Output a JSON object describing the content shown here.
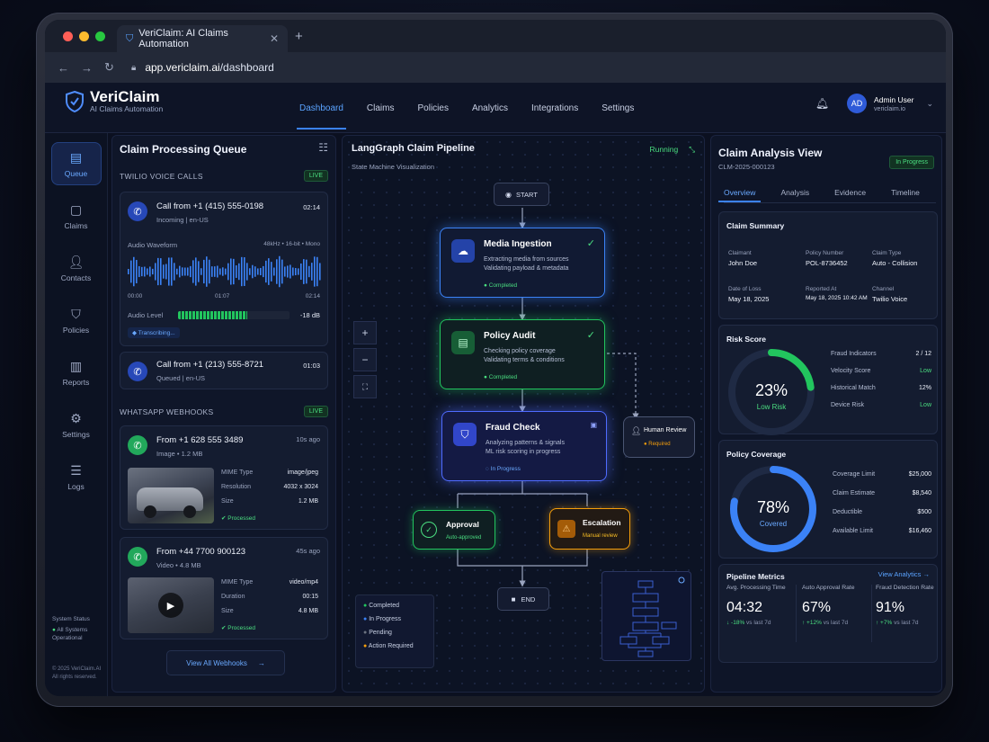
{
  "browser": {
    "tab_title": "VeriClaim: AI Claims Automation",
    "url_host": "app.vericlaim.ai",
    "url_path": "/dashboard"
  },
  "header": {
    "brand": "VeriClaim",
    "tagline": "AI Claims Automation",
    "nav": [
      "Dashboard",
      "Claims",
      "Policies",
      "Analytics",
      "Integrations",
      "Settings"
    ],
    "active_nav": "Dashboard",
    "user_initials": "AD",
    "user_name": "Admin User",
    "user_org": "vericlaim.io"
  },
  "sidebar": {
    "items": [
      {
        "label": "Queue",
        "icon": "queue-icon"
      },
      {
        "label": "Claims",
        "icon": "file-icon"
      },
      {
        "label": "Contacts",
        "icon": "contacts-icon"
      },
      {
        "label": "Policies",
        "icon": "shield-icon"
      },
      {
        "label": "Reports",
        "icon": "bar-chart-icon"
      },
      {
        "label": "Settings",
        "icon": "gear-icon"
      },
      {
        "label": "Logs",
        "icon": "logs-icon"
      }
    ],
    "status_title": "System Status",
    "status_text": "All Systems Operational",
    "copyright": "© 2025 VeriClaim.AI All rights reserved."
  },
  "queue": {
    "title": "Claim Processing Queue",
    "voice_section": "TWILIO VOICE CALLS",
    "voice_badge": "LIVE",
    "call1": {
      "title": "Call from +1 (415) 555-0198",
      "sub": "Incoming | en-US",
      "time": "02:14",
      "waveform_label": "Audio Waveform",
      "waveform_spec": "48kHz • 16-bit • Mono",
      "t0": "00:00",
      "t1": "01:07",
      "t2": "02:14",
      "level_label": "Audio Level",
      "level_db": "-18 dB",
      "level": 0.62,
      "transcribing": "Transcribing..."
    },
    "call2": {
      "title": "Call from +1 (213) 555-8721",
      "sub": "Queued | en-US",
      "time": "01:03"
    },
    "wa_section": "WHATSAPP WEBHOOKS",
    "wa_badge": "LIVE",
    "wa1": {
      "from": "From +1 628 555 3489",
      "ago": "10s ago",
      "sub": "Image • 1.2 MB",
      "k1": "MIME Type",
      "v1": "image/jpeg",
      "k2": "Resolution",
      "v2": "4032 x 3024",
      "k3": "Size",
      "v3": "1.2 MB",
      "status": "Processed"
    },
    "wa2": {
      "from": "From +44 7700 900123",
      "ago": "45s ago",
      "sub": "Video • 4.8 MB",
      "k1": "MIME Type",
      "v1": "video/mp4",
      "k2": "Duration",
      "v2": "00:15",
      "k3": "Size",
      "v3": "4.8 MB",
      "status": "Processed"
    },
    "view_all": "View All Webhooks"
  },
  "pipeline": {
    "title": "LangGraph Claim Pipeline",
    "subtitle": "State Machine Visualization",
    "status": "Running",
    "start": "START",
    "end": "END",
    "nodes": {
      "media": {
        "title": "Media Ingestion",
        "d1": "Extracting media from sources",
        "d2": "Validating payload & metadata",
        "status": "Completed"
      },
      "policy": {
        "title": "Policy Audit",
        "d1": "Checking policy coverage",
        "d2": "Validating terms & conditions",
        "status": "Completed"
      },
      "fraud": {
        "title": "Fraud Check",
        "d1": "Analyzing patterns & signals",
        "d2": "ML risk scoring in progress",
        "status": "In Progress"
      },
      "human": {
        "title": "Human Review",
        "status": "Required"
      },
      "approval": {
        "title": "Approval",
        "status": "Auto-approved"
      },
      "escalation": {
        "title": "Escalation",
        "status": "Manual review"
      }
    },
    "legend": [
      "Completed",
      "In Progress",
      "Pending",
      "Action Required"
    ],
    "legend_colors": [
      "#22c55e",
      "#3b82f6",
      "#6b7280",
      "#f59e0b"
    ]
  },
  "analysis": {
    "title": "Claim Analysis View",
    "claim_id": "CLM-2025-000123",
    "status": "In Progress",
    "tabs": [
      "Overview",
      "Analysis",
      "Evidence",
      "Timeline"
    ],
    "summary_title": "Claim Summary",
    "summary": [
      {
        "k": "Claimant",
        "v": "John Doe"
      },
      {
        "k": "Policy Number",
        "v": "POL-8736452"
      },
      {
        "k": "Claim Type",
        "v": "Auto - Collision"
      },
      {
        "k": "Date of Loss",
        "v": "May 18, 2025"
      },
      {
        "k": "Reported At",
        "v": "May 18, 2025 10:42 AM"
      },
      {
        "k": "Channel",
        "v": "Twilio Voice"
      }
    ],
    "risk": {
      "title": "Risk Score",
      "value": "23%",
      "fraction": 0.23,
      "label": "Low Risk",
      "rows": [
        {
          "k": "Fraud Indicators",
          "v": "2 / 12"
        },
        {
          "k": "Velocity Score",
          "v": "Low"
        },
        {
          "k": "Historical Match",
          "v": "12%"
        },
        {
          "k": "Device Risk",
          "v": "Low"
        }
      ]
    },
    "coverage": {
      "title": "Policy Coverage",
      "value": "78%",
      "fraction": 0.78,
      "label": "Covered",
      "rows": [
        {
          "k": "Coverage Limit",
          "v": "$25,000"
        },
        {
          "k": "Claim Estimate",
          "v": "$8,540"
        },
        {
          "k": "Deductible",
          "v": "$500"
        },
        {
          "k": "Available Limit",
          "v": "$16,460"
        }
      ]
    },
    "metrics": {
      "title": "Pipeline Metrics",
      "link": "View Analytics",
      "items": [
        {
          "k": "Avg. Processing Time",
          "v": "04:32",
          "d": "↓ -18%",
          "vs": "vs last 7d"
        },
        {
          "k": "Auto Approval Rate",
          "v": "67%",
          "d": "↑ +12%",
          "vs": "vs last 7d"
        },
        {
          "k": "Fraud Detection Rate",
          "v": "91%",
          "d": "↑ +7%",
          "vs": "vs last 7d"
        }
      ]
    }
  }
}
